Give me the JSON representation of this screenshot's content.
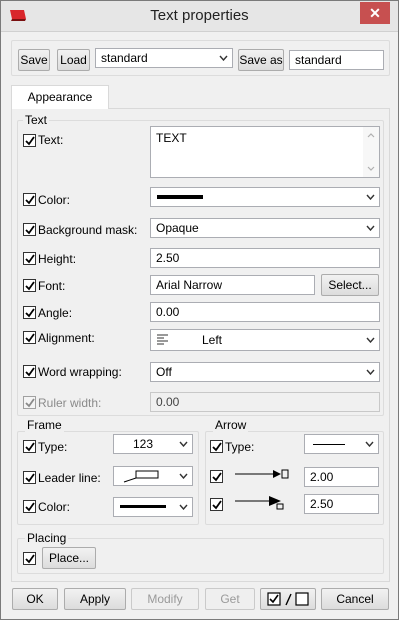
{
  "window": {
    "title": "Text properties",
    "close_glyph": "✕",
    "app_icon": "app-logo-icon"
  },
  "presets": {
    "save_label": "Save",
    "load_label": "Load",
    "selected_preset": "standard",
    "save_as_label": "Save as",
    "save_as_value": "standard"
  },
  "tabs": [
    {
      "label": "Appearance",
      "active": true
    }
  ],
  "text_group": {
    "title": "Text",
    "text_label": "Text:",
    "text_value": "TEXT",
    "color_label": "Color:",
    "color_value": "#000000",
    "background_mask_label": "Background mask:",
    "background_mask_value": "Opaque",
    "height_label": "Height:",
    "height_value": "2.50",
    "font_label": "Font:",
    "font_value": "Arial Narrow",
    "font_select_label": "Select...",
    "angle_label": "Angle:",
    "angle_value": "0.00",
    "alignment_label": "Alignment:",
    "alignment_value": "Left",
    "word_wrapping_label": "Word wrapping:",
    "word_wrapping_value": "Off",
    "ruler_width_label": "Ruler width:",
    "ruler_width_value": "0.00"
  },
  "frame_group": {
    "title": "Frame",
    "type_label": "Type:",
    "type_value": "123",
    "leader_line_label": "Leader line:",
    "color_label": "Color:"
  },
  "arrow_group": {
    "title": "Arrow",
    "type_label": "Type:",
    "arrow1_value": "2.00",
    "arrow2_value": "2.50"
  },
  "placing_group": {
    "title": "Placing",
    "place_label": "Place..."
  },
  "footer": {
    "ok_label": "OK",
    "apply_label": "Apply",
    "modify_label": "Modify",
    "get_label": "Get",
    "cancel_label": "Cancel"
  }
}
